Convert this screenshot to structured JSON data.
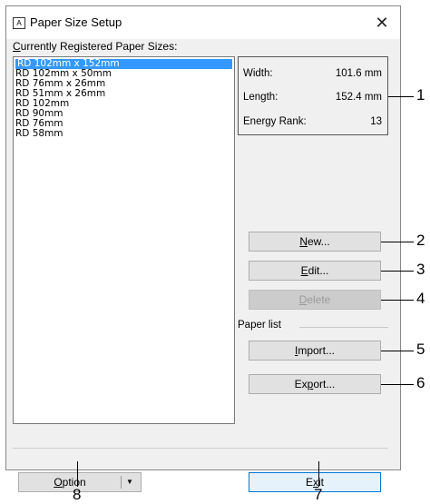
{
  "window": {
    "title": "Paper Size Setup",
    "icon_label": "A"
  },
  "list_label_u": "C",
  "list_label_rest": "urrently Registered Paper Sizes:",
  "paper_sizes": [
    "RD 102mm x 152mm",
    "RD 102mm x 50mm",
    "RD 76mm x 26mm",
    "RD 51mm x 26mm",
    "RD 102mm",
    "RD 90mm",
    "RD 76mm",
    "RD 58mm"
  ],
  "selected_index": 0,
  "info": {
    "width_label": "Width:",
    "width_value": "101.6 mm",
    "length_label": "Length:",
    "length_value": "152.4 mm",
    "energy_label": "Energy Rank:",
    "energy_value": "13"
  },
  "buttons": {
    "new": {
      "u": "N",
      "rest": "ew..."
    },
    "edit": {
      "u": "E",
      "rest": "dit..."
    },
    "delete": {
      "u": "D",
      "rest": "elete"
    },
    "import": {
      "u": "I",
      "rest": "mport..."
    },
    "export_pre": "Ex",
    "export_u": "p",
    "export_post": "ort...",
    "option_u": "O",
    "option_rest": "ption",
    "exit_pre": "E",
    "exit_u": "x",
    "exit_post": "it"
  },
  "paper_list_label": "Paper list",
  "callouts": {
    "c1": "1",
    "c2": "2",
    "c3": "3",
    "c4": "4",
    "c5": "5",
    "c6": "6",
    "c7": "7",
    "c8": "8"
  }
}
